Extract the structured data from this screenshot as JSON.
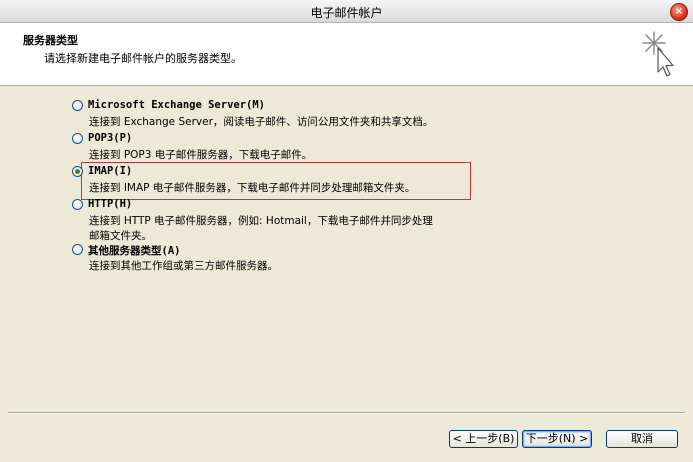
{
  "window": {
    "title": "电子邮件帐户",
    "close_glyph": "×"
  },
  "header": {
    "title": "服务器类型",
    "subtitle": "请选择新建电子邮件帐户的服务器类型。",
    "icon": "wizard-sparkle-cursor-icon"
  },
  "options": [
    {
      "label": "Microsoft Exchange Server(M)",
      "description": "连接到 Exchange Server，阅读电子邮件、访问公用文件夹和共享文档。",
      "selected": false
    },
    {
      "label": "POP3(P)",
      "description": "连接到 POP3 电子邮件服务器，下载电子邮件。",
      "selected": false
    },
    {
      "label": "IMAP(I)",
      "description": "连接到 IMAP 电子邮件服务器，下载电子邮件并同步处理邮箱文件夹。",
      "selected": true
    },
    {
      "label": "HTTP(H)",
      "description": "连接到 HTTP 电子邮件服务器，例如: Hotmail，下载电子邮件并同步处理\n邮箱文件夹。",
      "selected": false
    },
    {
      "label": "其他服务器类型(A)",
      "description": "连接到其他工作组或第三方邮件服务器。",
      "selected": false
    }
  ],
  "buttons": {
    "back": "< 上一步(B)",
    "next": "下一步(N) >",
    "cancel": "取消"
  },
  "colors": {
    "highlight_border": "#b63a3a",
    "dialog_bg": "#ece9d8"
  }
}
